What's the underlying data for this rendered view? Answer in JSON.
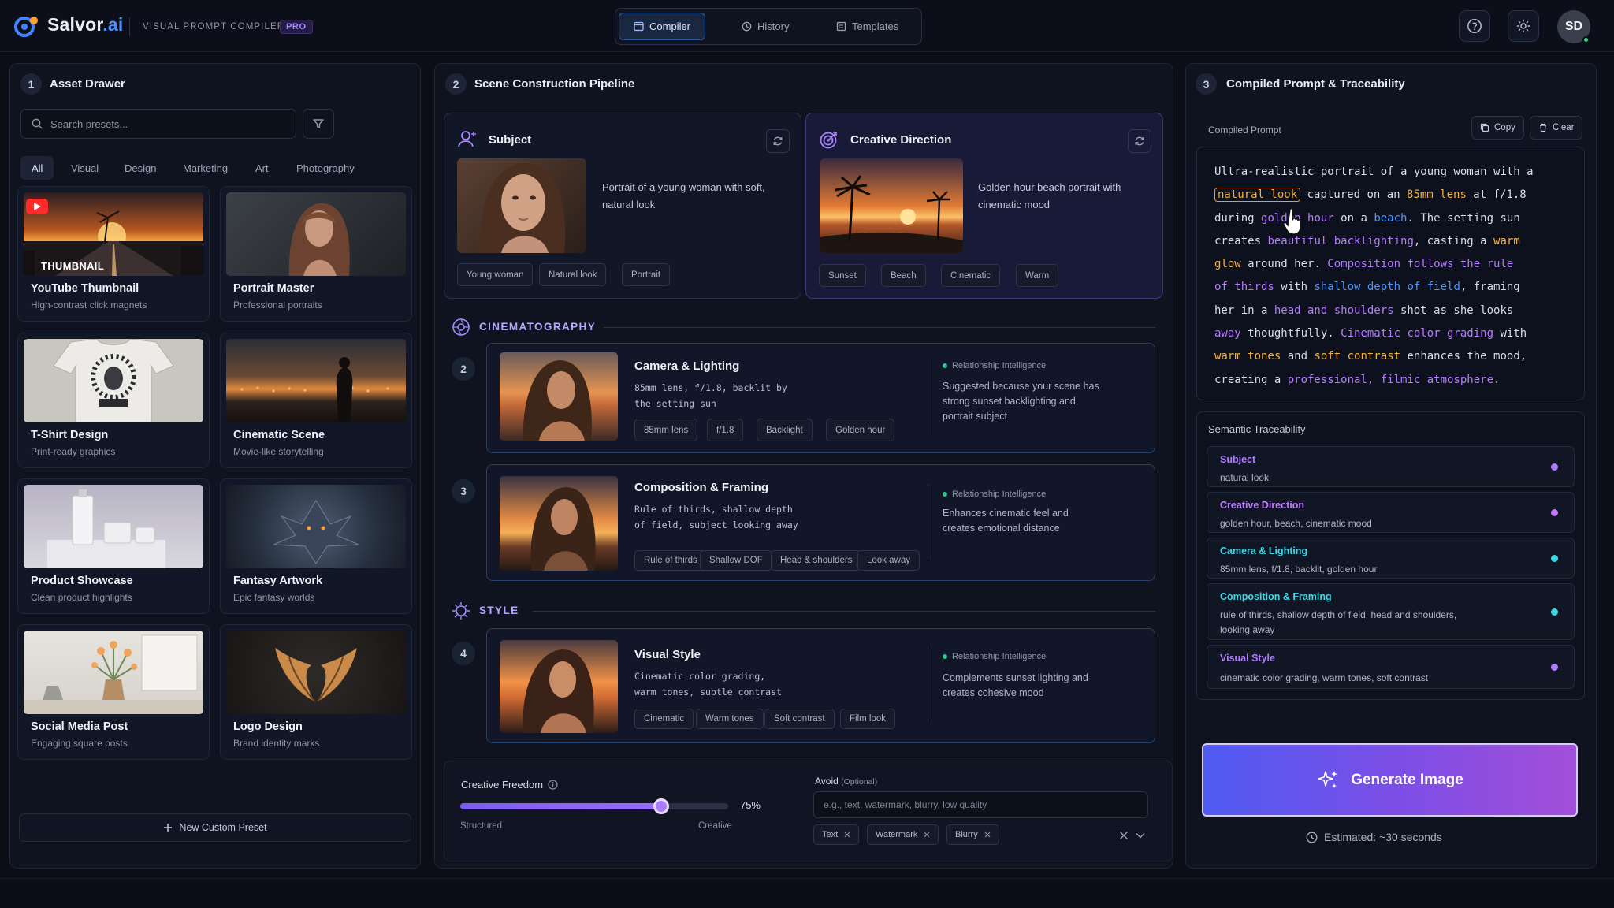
{
  "header": {
    "brand_main": "Salvor",
    "brand_ext": ".ai",
    "subtitle": "VISUAL PROMPT COMPILER",
    "badge": "PRO",
    "tabs": [
      {
        "label": "Compiler",
        "icon": "compiler-icon",
        "active": true
      },
      {
        "label": "History",
        "icon": "history-icon",
        "active": false
      },
      {
        "label": "Templates",
        "icon": "templates-icon",
        "active": false
      }
    ],
    "avatar_initials": "SD"
  },
  "asset_drawer": {
    "step": "1",
    "title": "Asset Drawer",
    "search_placeholder": "Search presets...",
    "categories": [
      "All",
      "Visual",
      "Design",
      "Marketing",
      "Art",
      "Photography"
    ],
    "active_category": "All",
    "presets": [
      {
        "title": "YouTube Thumbnail",
        "subtitle": "High-contrast click magnets",
        "thumb_text": "THUMBNAIL"
      },
      {
        "title": "Portrait Master",
        "subtitle": "Professional portraits"
      },
      {
        "title": "T-Shirt Design",
        "subtitle": "Print-ready graphics"
      },
      {
        "title": "Cinematic Scene",
        "subtitle": "Movie-like storytelling"
      },
      {
        "title": "Product Showcase",
        "subtitle": "Clean product highlights"
      },
      {
        "title": "Fantasy Artwork",
        "subtitle": "Epic fantasy worlds"
      },
      {
        "title": "Social Media Post",
        "subtitle": "Engaging square posts"
      },
      {
        "title": "Logo Design",
        "subtitle": "Brand identity marks"
      }
    ],
    "new_preset_label": "New Custom Preset"
  },
  "pipeline": {
    "step": "2",
    "title": "Scene Construction Pipeline",
    "subject": {
      "title": "Subject",
      "description": "Portrait of a young woman with soft, natural look",
      "chips": [
        "Young woman",
        "Natural look",
        "Portrait"
      ]
    },
    "creative": {
      "title": "Creative Direction",
      "description": "Golden hour beach portrait with cinematic mood",
      "chips": [
        "Sunset",
        "Beach",
        "Cinematic",
        "Warm"
      ]
    },
    "sections": {
      "cinematography": "CINEMATOGRAPHY",
      "style": "STYLE"
    },
    "rows": [
      {
        "step": "2",
        "title": "Camera & Lighting",
        "desc_line1": "85mm lens, f/1.8, backlit by",
        "desc_line2": "the setting sun",
        "chips": [
          "85mm lens",
          "f/1.8",
          "Backlight",
          "Golden hour"
        ],
        "ri_label": "Relationship Intelligence",
        "ri_text": "Suggested because your scene has strong sunset backlighting and portrait subject"
      },
      {
        "step": "3",
        "title": "Composition & Framing",
        "desc_line1": "Rule of thirds, shallow depth",
        "desc_line2": "of field, subject looking away",
        "chips": [
          "Rule of thirds",
          "Shallow DOF",
          "Head & shoulders",
          "Look away"
        ],
        "ri_label": "Relationship Intelligence",
        "ri_text": "Enhances cinematic feel and creates emotional distance"
      },
      {
        "step": "4",
        "title": "Visual Style",
        "desc_line1": "Cinematic color grading,",
        "desc_line2": "warm tones, subtle contrast",
        "chips": [
          "Cinematic",
          "Warm tones",
          "Soft contrast",
          "Film look"
        ],
        "ri_label": "Relationship Intelligence",
        "ri_text": "Complements sunset lighting and creates cohesive mood"
      }
    ],
    "freedom": {
      "label": "Creative Freedom",
      "value": 0.75,
      "value_label": "75%",
      "min_label": "Structured",
      "max_label": "Creative"
    },
    "avoid": {
      "label": "Avoid",
      "optional": "(Optional)",
      "placeholder": "e.g., text, watermark, blurry, low quality",
      "tags": [
        "Text",
        "Watermark",
        "Blurry"
      ]
    }
  },
  "compiled": {
    "step": "3",
    "title": "Compiled Prompt & Traceability",
    "prompt_label": "Compiled Prompt",
    "copy_label": "Copy",
    "clear_label": "Clear",
    "prompt_lines": [
      [
        {
          "t": "Ultra-realistic portrait of a young woman with a"
        }
      ],
      [
        {
          "t": "natural look",
          "c": "box"
        },
        {
          "t": " captured on an "
        },
        {
          "t": "85mm lens",
          "c": "o"
        },
        {
          "t": " at f/1.8"
        }
      ],
      [
        {
          "t": "during "
        },
        {
          "t": "golden hour",
          "c": "p"
        },
        {
          "t": " on a "
        },
        {
          "t": "beach",
          "c": "b"
        },
        {
          "t": ". The setting sun"
        }
      ],
      [
        {
          "t": "creates "
        },
        {
          "t": "beautiful backlighting",
          "c": "p"
        },
        {
          "t": ", casting a "
        },
        {
          "t": "warm",
          "c": "o"
        }
      ],
      [
        {
          "t": "glow",
          "c": "o"
        },
        {
          "t": " around her. "
        },
        {
          "t": "Composition follows the rule",
          "c": "p"
        }
      ],
      [
        {
          "t": "of thirds",
          "c": "p"
        },
        {
          "t": " with "
        },
        {
          "t": "shallow depth of field",
          "c": "b"
        },
        {
          "t": ", framing"
        }
      ],
      [
        {
          "t": "her in a "
        },
        {
          "t": "head and shoulders",
          "c": "p"
        },
        {
          "t": " shot as she looks"
        }
      ],
      [
        {
          "t": "away",
          "c": "p"
        },
        {
          "t": " thoughtfully. "
        },
        {
          "t": "Cinematic color grading",
          "c": "p"
        },
        {
          "t": " with"
        }
      ],
      [
        {
          "t": "warm tones",
          "c": "o"
        },
        {
          "t": " and "
        },
        {
          "t": "soft contrast",
          "c": "o"
        },
        {
          "t": " enhances the mood,"
        }
      ],
      [
        {
          "t": "creating a "
        },
        {
          "t": "professional, filmic atmosphere",
          "c": "p"
        },
        {
          "t": "."
        }
      ]
    ],
    "trace_title": "Semantic Traceability",
    "trace": [
      {
        "name": "Subject",
        "value": "natural look",
        "color": "#b07cff"
      },
      {
        "name": "Creative Direction",
        "value": "golden hour, beach, cinematic mood",
        "color": "#c07bff"
      },
      {
        "name": "Camera & Lighting",
        "value": "85mm lens, f/1.8, backlit, golden hour",
        "color": "#3fd6e6"
      },
      {
        "name": "Composition & Framing",
        "value": "rule of thirds, shallow depth of field, head and shoulders, looking away",
        "color": "#3fd6e6"
      },
      {
        "name": "Visual Style",
        "value": "cinematic color grading, warm tones, soft contrast",
        "color": "#b07cff"
      }
    ],
    "generate_label": "Generate Image",
    "estimate": "Estimated: ~30 seconds"
  },
  "colors": {
    "accent": "#4b8cff",
    "purple": "#b57cff",
    "orange": "#f5b13d"
  }
}
